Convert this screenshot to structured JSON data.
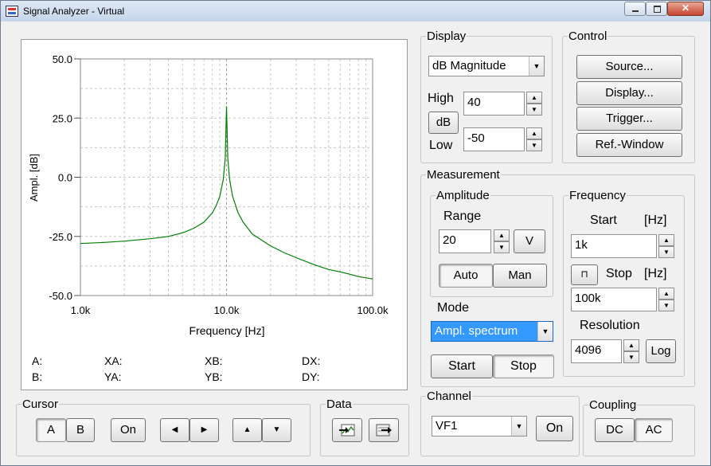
{
  "window": {
    "title": "Signal Analyzer - Virtual"
  },
  "plot": {
    "ylabel": "Ampl. [dB]",
    "xlabel": "Frequency [Hz]",
    "yticks": [
      "50.0",
      "25.0",
      "0.0",
      "-25.0",
      "-50.0"
    ],
    "xticks": [
      "1.0k",
      "10.0k",
      "100.0k"
    ],
    "trace_color": "#008000"
  },
  "chart_data": {
    "type": "line",
    "xlabel": "Frequency [Hz]",
    "ylabel": "Ampl. [dB]",
    "xscale": "log",
    "xlim": [
      1000,
      100000
    ],
    "ylim": [
      -50,
      50
    ],
    "grid": true,
    "x": [
      1000,
      1500,
      2000,
      3000,
      4000,
      5000,
      6000,
      7000,
      8000,
      8500,
      9000,
      9500,
      9800,
      10000,
      10200,
      10500,
      11000,
      12000,
      13000,
      15000,
      20000,
      25000,
      30000,
      40000,
      50000,
      60000,
      70000,
      80000,
      100000
    ],
    "y": [
      -28,
      -27.5,
      -27,
      -26,
      -25,
      -23.5,
      -21.5,
      -19,
      -15,
      -12,
      -8,
      -1,
      8,
      30,
      8,
      -1,
      -8,
      -15,
      -19,
      -24,
      -29,
      -32,
      -34,
      -37,
      -39,
      -40,
      -41,
      -42,
      -43
    ]
  },
  "cursor_readout": {
    "a": "A:",
    "b": "B:",
    "xa": "XA:",
    "ya": "YA:",
    "xb": "XB:",
    "yb": "YB:",
    "dx": "DX:",
    "dy": "DY:"
  },
  "display": {
    "legend": "Display",
    "mode_selected": "dB Magnitude",
    "high_label": "High",
    "low_label": "Low",
    "unit_button": "dB",
    "high_value": "40",
    "low_value": "-50"
  },
  "control": {
    "legend": "Control",
    "source": "Source...",
    "display": "Display...",
    "trigger": "Trigger...",
    "ref_window": "Ref.-Window"
  },
  "measurement": {
    "legend": "Measurement",
    "amplitude": {
      "legend": "Amplitude",
      "range_label": "Range",
      "range_value": "20",
      "unit_button": "V",
      "auto": "Auto",
      "man": "Man"
    },
    "mode_label": "Mode",
    "mode_selected": "Ampl. spectrum",
    "start": "Start",
    "stop": "Stop",
    "frequency": {
      "legend": "Frequency",
      "start_label": "Start",
      "start_unit": "[Hz]",
      "start_value": "1k",
      "stop_label": "Stop",
      "stop_unit": "[Hz]",
      "stop_value": "100k",
      "resolution_label": "Resolution",
      "resolution_value": "4096",
      "log_button": "Log"
    }
  },
  "cursor": {
    "legend": "Cursor",
    "a": "A",
    "b": "B",
    "on": "On"
  },
  "data_group": {
    "legend": "Data"
  },
  "channel": {
    "legend": "Channel",
    "selected": "VF1",
    "on": "On"
  },
  "coupling": {
    "legend": "Coupling",
    "dc": "DC",
    "ac": "AC"
  }
}
